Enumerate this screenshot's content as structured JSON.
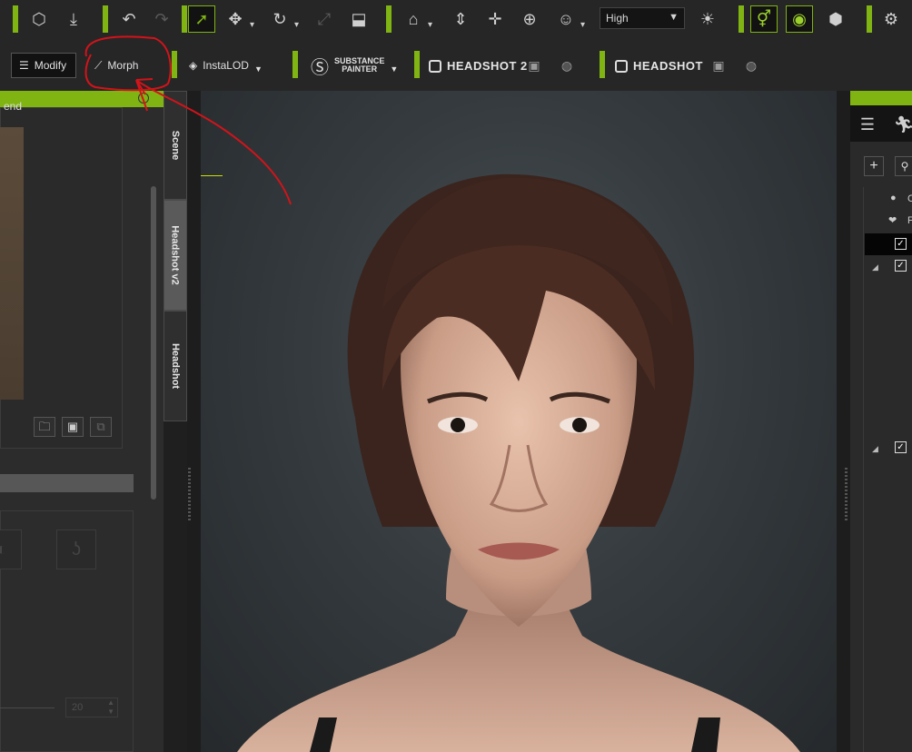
{
  "toolbar": {
    "quality_select": {
      "value": "High"
    }
  },
  "secondary_toolbar": {
    "modify_label": "Modify",
    "morph_label": "Morph",
    "instalod_label": "InstaLOD",
    "substance_line1": "SUBSTANCE",
    "substance_line2": "PAINTER",
    "headshot2_label": "HEADSHOT 2",
    "headshot_label": "HEADSHOT"
  },
  "left_panel": {
    "header_fragment": "end",
    "spinner_value": "20"
  },
  "vertical_tabs": [
    {
      "label": "Scene"
    },
    {
      "label": "Headshot v2"
    },
    {
      "label": "Headshot"
    }
  ],
  "right_panel": {
    "rows": [
      {
        "fragment": "C"
      },
      {
        "fragment": "F"
      }
    ]
  },
  "colors": {
    "accent": "#7fb413",
    "annotation": "#d3131a"
  }
}
